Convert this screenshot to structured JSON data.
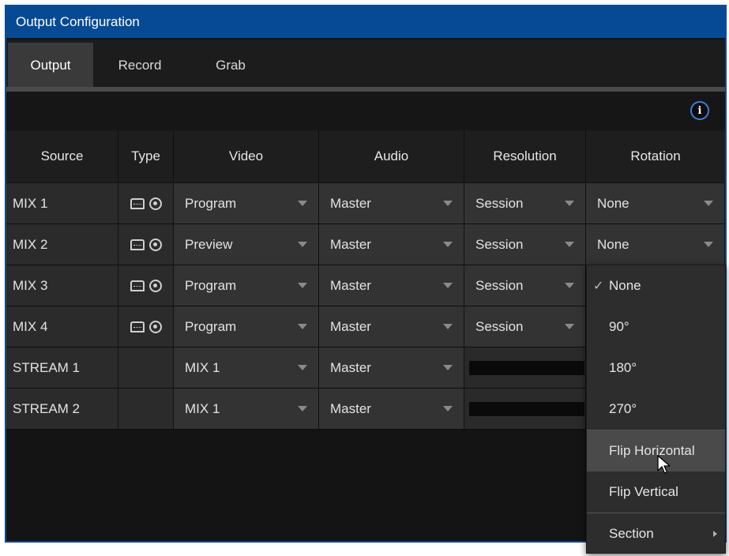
{
  "window": {
    "title": "Output Configuration"
  },
  "tabs": [
    {
      "label": "Output",
      "active": true
    },
    {
      "label": "Record",
      "active": false
    },
    {
      "label": "Grab",
      "active": false
    }
  ],
  "info_icon": {
    "glyph": "i",
    "icon": "info-icon"
  },
  "columns": [
    "Source",
    "Type",
    "Video",
    "Audio",
    "Resolution",
    "Rotation"
  ],
  "rows": [
    {
      "source": "MIX 1",
      "has_type_icons": true,
      "video": "Program",
      "audio": "Master",
      "resolution": "Session",
      "rotation": "None"
    },
    {
      "source": "MIX 2",
      "has_type_icons": true,
      "video": "Preview",
      "audio": "Master",
      "resolution": "Session",
      "rotation": "None"
    },
    {
      "source": "MIX 3",
      "has_type_icons": true,
      "video": "Program",
      "audio": "Master",
      "resolution": "Session",
      "rotation": ""
    },
    {
      "source": "MIX 4",
      "has_type_icons": true,
      "video": "Program",
      "audio": "Master",
      "resolution": "Session",
      "rotation": ""
    },
    {
      "source": "STREAM 1",
      "has_type_icons": false,
      "video": "MIX 1",
      "audio": "Master",
      "resolution": "",
      "rotation": ""
    },
    {
      "source": "STREAM 2",
      "has_type_icons": false,
      "video": "MIX 1",
      "audio": "Master",
      "resolution": "",
      "rotation": ""
    }
  ],
  "rotation_menu": {
    "items": [
      {
        "label": "None",
        "checked": true
      },
      {
        "label": "90°",
        "checked": false
      },
      {
        "label": "180°",
        "checked": false
      },
      {
        "label": "270°",
        "checked": false
      }
    ],
    "flip_items": [
      {
        "label": "Flip Horizontal",
        "hovered": true
      },
      {
        "label": "Flip Vertical",
        "hovered": false
      }
    ],
    "section_item": {
      "label": "Section",
      "has_submenu": true
    }
  },
  "colors": {
    "title_bar": "#064a95",
    "window_border": "#0a4c96",
    "info_ring": "#3c7ed6",
    "background": "#141414"
  }
}
